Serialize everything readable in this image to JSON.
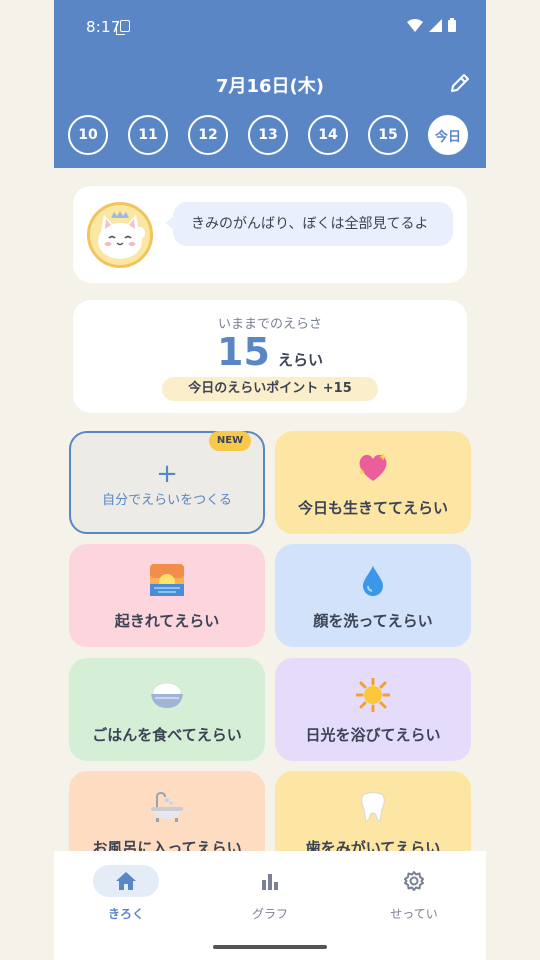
{
  "status_bar": {
    "time": "8:17"
  },
  "header": {
    "title": "7月16日(木)",
    "dates": [
      "10",
      "11",
      "12",
      "13",
      "14",
      "15"
    ],
    "today_label": "今日"
  },
  "message": {
    "text": "きみのがんばり、ぼくは全部見てるよ"
  },
  "score": {
    "label": "いままでのえらさ",
    "value": "15",
    "unit": "えらい",
    "today": "今日のえらいポイント  +15"
  },
  "tiles": {
    "create": {
      "label": "自分でえらいをつくる",
      "plus": "+",
      "badge": "NEW"
    },
    "alive": {
      "label": "今日も生きててえらい",
      "icon": "sparkling-heart-icon",
      "color": "#fde6a3"
    },
    "wakeup": {
      "label": "起きれてえらい",
      "icon": "sunrise-icon",
      "color": "#fdd5dd"
    },
    "wash_face": {
      "label": "顔を洗ってえらい",
      "icon": "droplet-icon",
      "color": "#d2e2fb"
    },
    "meal": {
      "label": "ごはんを食べてえらい",
      "icon": "rice-bowl-icon",
      "color": "#d4efd6"
    },
    "sunlight": {
      "label": "日光を浴びてえらい",
      "icon": "sun-icon",
      "color": "#e5dcfb"
    },
    "bath": {
      "label": "お風呂に入ってえらい",
      "icon": "bathtub-icon",
      "color": "#fddcc2"
    },
    "teeth": {
      "label": "歯をみがいてえらい",
      "icon": "tooth-icon",
      "color": "#fde6a3"
    }
  },
  "nav": {
    "record": "きろく",
    "graph": "グラフ",
    "settings": "せってい"
  },
  "colors": {
    "accent": "#5b86c6",
    "background": "#f5f2ea"
  }
}
